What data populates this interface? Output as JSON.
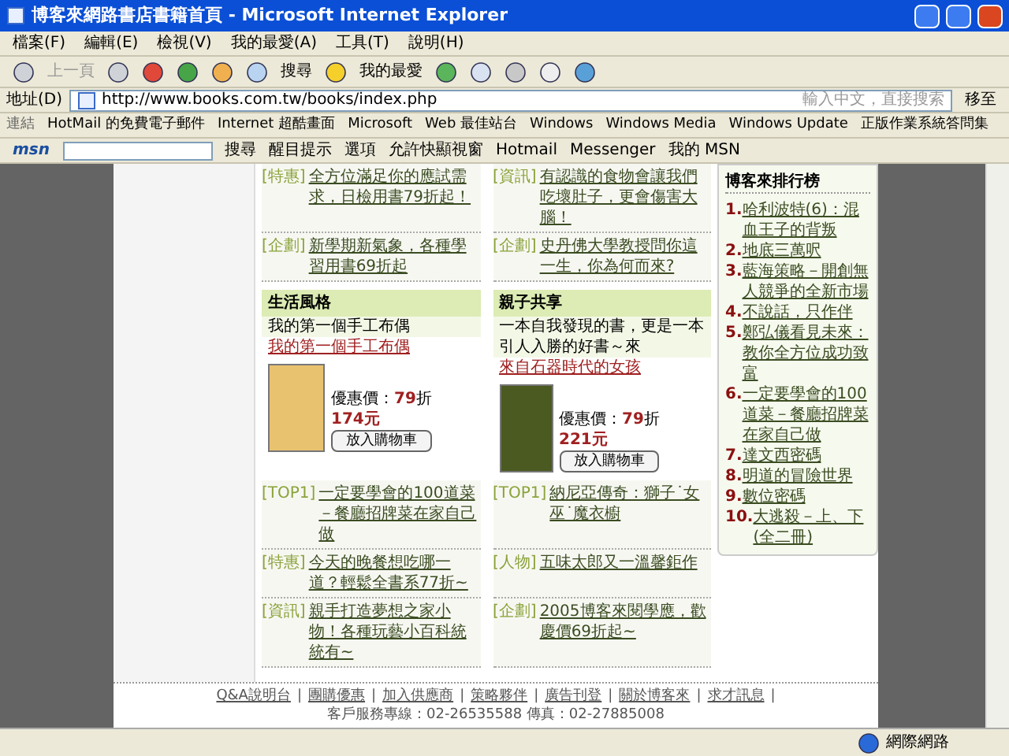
{
  "window": {
    "title": "博客來網路書店書籍首頁 - Microsoft Internet Explorer"
  },
  "menu": [
    "檔案(F)",
    "編輯(E)",
    "檢視(V)",
    "我的最愛(A)",
    "工具(T)",
    "說明(H)"
  ],
  "toolbar": {
    "back": "上一頁",
    "search": "搜尋",
    "favorites": "我的最愛"
  },
  "address_bar": {
    "label": "地址(D)",
    "url": "http://www.books.com.tw/books/index.php",
    "search_placeholder": "輸入中文，直接搜索",
    "go": "移至"
  },
  "links_bar": {
    "label": "連結",
    "items": [
      "HotMail 的免費電子郵件",
      "Internet 超酷畫面",
      "Microsoft",
      "Web 最佳站台",
      "Windows",
      "Windows Media",
      "Windows Update",
      "正版作業系統答問集"
    ]
  },
  "msn_bar": {
    "logo": "msn",
    "items": [
      "搜尋",
      "醒目提示",
      "選項",
      "允許快顯視窗",
      "Hotmail",
      "Messenger",
      "我的 MSN"
    ]
  },
  "top_news": [
    {
      "tag": "[特惠]",
      "text": "全方位滿足你的應試需求，日檢用書79折起！"
    },
    {
      "tag": "[資訊]",
      "text": "有認識的食物會讓我們吃壞肚子，更會傷害大腦！"
    },
    {
      "tag": "[企劃]",
      "text": "新學期新氣象，各種學習用書69折起"
    },
    {
      "tag": "[企劃]",
      "text": "史丹佛大學教授問你這一生，你為何而來?"
    }
  ],
  "cards": [
    {
      "heading": "生活風格",
      "blurb": "我的第一個手工布偶",
      "link": "我的第一個手工布偶",
      "price_label": "優惠價：",
      "discount": "79",
      "discount_unit": "折",
      "price": "174元",
      "button": "放入購物車"
    },
    {
      "heading": "親子共享",
      "blurb": "一本自我發現的書，更是一本引人入勝的好書～來",
      "link": "來自石器時代的女孩",
      "price_label": "優惠價：",
      "discount": "79",
      "discount_unit": "折",
      "price": "221元",
      "button": "放入購物車"
    }
  ],
  "bottom_news": [
    {
      "tag": "[TOP1]",
      "text": "一定要學會的100道菜－餐廳招牌菜在家自己做"
    },
    {
      "tag": "[TOP1]",
      "text": "納尼亞傳奇：獅子˙女巫˙魔衣櫥"
    },
    {
      "tag": "[特惠]",
      "text": "今天的晚餐想吃哪一道？輕鬆全書系77折~"
    },
    {
      "tag": "[人物]",
      "text": "五味太郎又一溫馨鉅作"
    },
    {
      "tag": "[資訊]",
      "text": "親手打造夢想之家小物！各種玩藝小百科統統有~"
    },
    {
      "tag": "[企劃]",
      "text": "2005博客來閱學應，歡慶價69折起~"
    }
  ],
  "ranking": {
    "title": "博客來排行榜",
    "items": [
      {
        "rank": "1.",
        "title": "哈利波特(6)：混血王子的背叛"
      },
      {
        "rank": "2.",
        "title": "地底三萬呎"
      },
      {
        "rank": "3.",
        "title": "藍海策略－開創無人競爭的全新市場"
      },
      {
        "rank": "4.",
        "title": "不說話，只作伴"
      },
      {
        "rank": "5.",
        "title": "鄭弘儀看見未來：教你全方位成功致富"
      },
      {
        "rank": "6.",
        "title": "一定要學會的100道菜－餐廳招牌菜在家自己做"
      },
      {
        "rank": "7.",
        "title": "達文西密碼"
      },
      {
        "rank": "8.",
        "title": "明道的冒險世界"
      },
      {
        "rank": "9.",
        "title": "數位密碼"
      },
      {
        "rank": "10.",
        "title": "大逃殺－上、下 (全二冊)"
      }
    ]
  },
  "footer": {
    "links": [
      "Q&A說明台",
      "團購優惠",
      "加入供應商",
      "策略夥伴",
      "廣告刊登",
      "關於博客來",
      "求才訊息"
    ],
    "separator": "|",
    "contact": "客戶服務專線：02-26535588 傳真：02-27885008"
  },
  "status_bar": {
    "zone": "網際網路"
  }
}
